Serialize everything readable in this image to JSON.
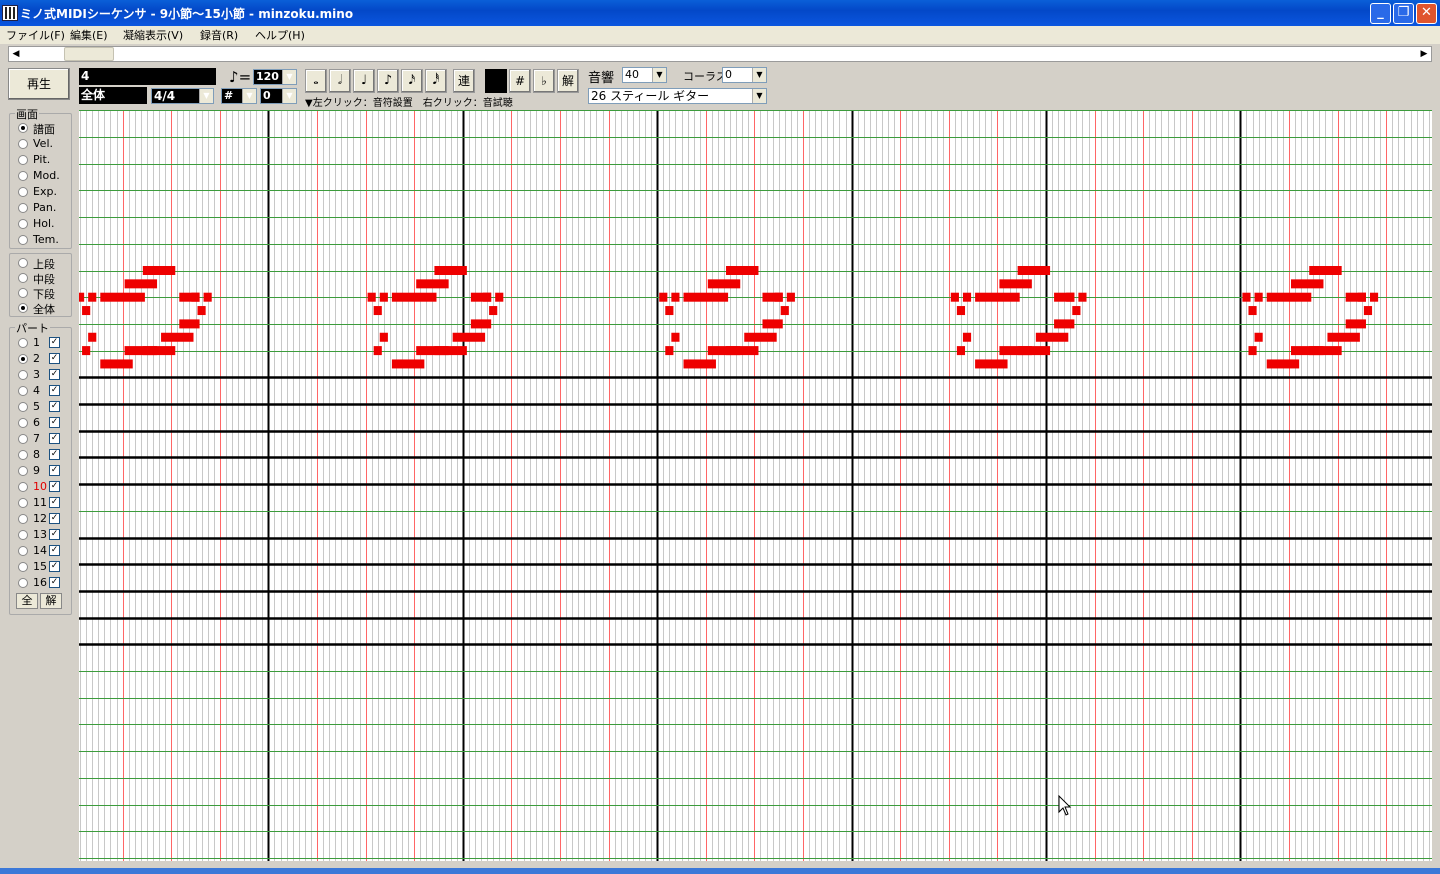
{
  "window": {
    "title": "ミノ式MIDIシーケンサ - 9小節〜15小節 - minzoku.mino",
    "minimize_label": "_",
    "restore_label": "❐",
    "close_label": "✕"
  },
  "menu": [
    "ファイル(F)",
    "編集(E)",
    "凝縮表示(V)",
    "録音(R)",
    "ヘルプ(H)"
  ],
  "toolbar": {
    "play_label": "再生",
    "measure_value": "4",
    "range_value": "全体",
    "time_signature": "4/4",
    "tempo_symbol": "♪=",
    "tempo_value": "120",
    "key_accidental": "#",
    "key_value": "0",
    "note_buttons": [
      "𝅝",
      "𝅗𝅥",
      "♩",
      "♪",
      "𝅘𝅥𝅯",
      "𝅘𝅥𝅰"
    ],
    "ren_label": "連",
    "sharp_label": "#",
    "flat_label": "♭",
    "natural_label": "解",
    "hint": "▼左クリック：音符設置　右クリック：音試聴",
    "reverb_label": "音響",
    "reverb_value": "40",
    "chorus_label": "コーラス",
    "chorus_value": "0",
    "instrument_value": "26 スティール ギター"
  },
  "screen_panel": {
    "caption": "画面",
    "options": [
      "譜面",
      "Vel.",
      "Pit.",
      "Mod.",
      "Exp.",
      "Pan.",
      "Hol.",
      "Tem."
    ],
    "selected": 0
  },
  "staff_panel": {
    "options": [
      "上段",
      "中段",
      "下段",
      "全体"
    ],
    "selected": 3
  },
  "part_panel": {
    "caption": "パート",
    "parts": [
      "1",
      "2",
      "3",
      "4",
      "5",
      "6",
      "7",
      "8",
      "9",
      "10",
      "11",
      "12",
      "13",
      "14",
      "15",
      "16"
    ],
    "selected": 1,
    "checked": [
      true,
      true,
      true,
      true,
      true,
      true,
      true,
      true,
      true,
      true,
      true,
      true,
      true,
      true,
      true,
      true
    ],
    "highlight_index": 9,
    "all_label": "全",
    "clear_label": "解"
  },
  "score": {
    "note_color": "#ee0000",
    "measure_line_color": "#000000",
    "beat_line_color": "#ff6666",
    "pitch_line_color": "#3c9c3c",
    "rows": 28,
    "staff_rows": [
      9,
      10,
      11,
      12,
      13,
      15,
      16,
      17,
      18,
      19
    ],
    "grid_columns_per_measure": 32,
    "pattern_columns": 48,
    "pattern_notes": [
      [
        0,
        12,
        1
      ],
      [
        1,
        13,
        1
      ],
      [
        2,
        12,
        1
      ],
      [
        4,
        12,
        4
      ],
      [
        2,
        15,
        1
      ],
      [
        1,
        16,
        1
      ],
      [
        4,
        17,
        3
      ],
      [
        8,
        16,
        3
      ],
      [
        8,
        11,
        3
      ],
      [
        11,
        10,
        3
      ],
      [
        11,
        16,
        3
      ],
      [
        14,
        15,
        3
      ],
      [
        17,
        12,
        2
      ],
      [
        17,
        14,
        2
      ],
      [
        19,
        12,
        1
      ],
      [
        20,
        13,
        1
      ],
      [
        21,
        12,
        1
      ]
    ]
  }
}
